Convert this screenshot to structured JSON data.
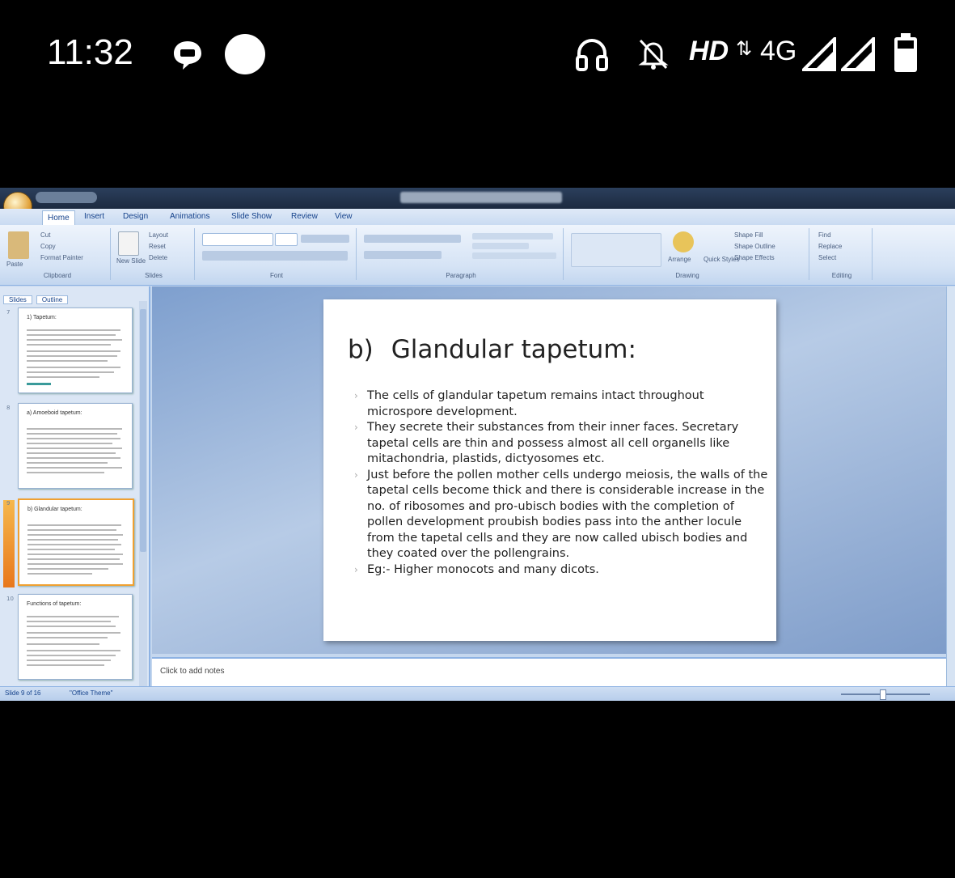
{
  "status_bar": {
    "time": "11:32",
    "network_hd": "HD",
    "network_arrows": "⇅",
    "network_type": "4G",
    "icons": [
      "message-icon",
      "circle-icon",
      "headphones-icon",
      "bell-off-icon",
      "signal-icon",
      "signal-icon",
      "battery-icon"
    ]
  },
  "ppt": {
    "ribbon_tabs": [
      "Home",
      "Insert",
      "Design",
      "Animations",
      "Slide Show",
      "Review",
      "View"
    ],
    "ribbon_groups": [
      "Clipboard",
      "Slides",
      "Font",
      "Paragraph",
      "Drawing",
      "Editing"
    ],
    "clipboard": {
      "paste": "Paste",
      "cut": "Cut",
      "copy": "Copy",
      "format_painter": "Format Painter"
    },
    "slides_group": {
      "new_slide": "New Slide",
      "layout": "Layout",
      "reset": "Reset",
      "delete": "Delete"
    },
    "drawing": {
      "arrange": "Arrange",
      "quick_styles": "Quick Styles",
      "shape_fill": "Shape Fill",
      "shape_outline": "Shape Outline",
      "shape_effects": "Shape Effects"
    },
    "editing": {
      "find": "Find",
      "replace": "Replace",
      "select": "Select"
    },
    "left_panel_tabs": [
      "Slides",
      "Outline"
    ],
    "thumbnails": [
      {
        "num": "7",
        "title": "1) Tapetum:"
      },
      {
        "num": "8",
        "title": "a) Amoeboid tapetum:"
      },
      {
        "num": "9",
        "title": "b) Glandular tapetum:"
      },
      {
        "num": "10",
        "title": "Functions of tapetum:"
      }
    ],
    "slide": {
      "title_num": "b)",
      "title_text": "Glandular tapetum:",
      "bullets": [
        "The cells of glandular tapetum remains intact throughout microspore development.",
        "They secrete their substances from their inner faces. Secretary tapetal cells are thin and possess almost all cell organells like mitachondria, plastids, dictyosomes etc.",
        "Just before the pollen mother cells undergo meiosis, the walls of the tapetal cells become thick and there is considerable increase in the no. of ribosomes and pro-ubisch bodies with the completion of pollen development proubish bodies pass into the anther locule from the tapetal cells and they are now called ubisch bodies and they coated over the pollengrains.",
        "Eg:- Higher monocots and many dicots."
      ]
    },
    "notes_placeholder": "Click to add notes",
    "status": {
      "slide_counter": "Slide 9 of 16",
      "theme": "\"Office Theme\""
    }
  }
}
